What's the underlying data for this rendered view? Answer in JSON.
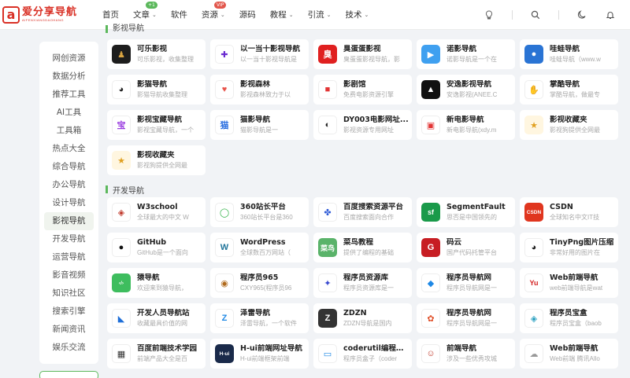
{
  "header": {
    "logo_mark": "a",
    "logo_title": "爱分享导航",
    "logo_sub": "AIFENXIANGDAOHANG",
    "nav": [
      {
        "label": "首页",
        "caret": false,
        "badge": ""
      },
      {
        "label": "文章",
        "caret": true,
        "badge": "+1",
        "badge_color": "#5cb85c"
      },
      {
        "label": "软件",
        "caret": false,
        "badge": ""
      },
      {
        "label": "资源",
        "caret": true,
        "badge": "VIP",
        "badge_color": "#e2574c"
      },
      {
        "label": "源码",
        "caret": false,
        "badge": ""
      },
      {
        "label": "教程",
        "caret": true,
        "badge": ""
      },
      {
        "label": "引流",
        "caret": true,
        "badge": ""
      },
      {
        "label": "技术",
        "caret": true,
        "badge": ""
      }
    ]
  },
  "sidebar": {
    "items": [
      "网创资源",
      "数据分析",
      "推荐工具",
      "AI工具",
      "工具箱",
      "热点大全",
      "综合导航",
      "办公导航",
      "设计导航",
      "影视导航",
      "开发导航",
      "运营导航",
      "影音视频",
      "知识社区",
      "搜索引擎",
      "新闻资讯",
      "娱乐交流"
    ],
    "active": "影视导航"
  },
  "sections": [
    {
      "title": "影视导航",
      "cards": [
        {
          "name": "可乐影视",
          "desc": "可乐影视，收集整理",
          "icon": "cola-icon",
          "bg": "#1d1d1d",
          "fg": "#d9a441",
          "glyph": "♟"
        },
        {
          "name": "以一当十影视导航",
          "desc": "以一当十影视导航是",
          "icon": "plus-logo-icon",
          "bg": "#fff",
          "fg": "#6a2bd0",
          "glyph": "✚"
        },
        {
          "name": "臭蛋蛋影视",
          "desc": "臭蛋蛋影视导航，影",
          "icon": "smelly-egg-icon",
          "bg": "#e02020",
          "fg": "#fff",
          "glyph": "臭"
        },
        {
          "name": "诺影导航",
          "desc": "诺影导航是一个在",
          "icon": "play-icon",
          "bg": "#3fa0f0",
          "fg": "#fff",
          "glyph": "▶"
        },
        {
          "name": "哇蛙导航",
          "desc": "哇蛙导航（www.w",
          "icon": "frog-icon",
          "bg": "#2a74d4",
          "fg": "#fff",
          "glyph": "●"
        },
        {
          "name": "影猫导航",
          "desc": "影猫导航收集整理",
          "icon": "panda-icon",
          "bg": "#fff",
          "fg": "#222",
          "glyph": "◕"
        },
        {
          "name": "影视森林",
          "desc": "影视森林致力于以",
          "icon": "heart-icon",
          "bg": "#fff",
          "fg": "#e8534a",
          "glyph": "♥"
        },
        {
          "name": "影剧馆",
          "desc": "免费电影资源引擎",
          "icon": "camera-icon",
          "bg": "#fff",
          "fg": "#e23434",
          "glyph": "■"
        },
        {
          "name": "安逸影视导航",
          "desc": "安逸影视(ANEE.C",
          "icon": "triangle-icon",
          "bg": "#111",
          "fg": "#fff",
          "glyph": "▲"
        },
        {
          "name": "掌酷导航",
          "desc": "掌酷导航，做最专",
          "icon": "hand-icon",
          "bg": "#fff",
          "fg": "#3b8ee0",
          "glyph": "✋"
        },
        {
          "name": "影视宝藏导航",
          "desc": "影视宝藏导航，一个",
          "icon": "treasure-icon",
          "bg": "#fff",
          "fg": "#9b3fe0",
          "glyph": "宝"
        },
        {
          "name": "猫影导航",
          "desc": "猫影导航是一",
          "icon": "cat-icon",
          "bg": "#fff",
          "fg": "#2b6fe0",
          "glyph": "猫"
        },
        {
          "name": "DY003电影网址...",
          "desc": "影视资源专用网址",
          "icon": "dy-icon",
          "bg": "#fff",
          "fg": "#222",
          "glyph": "◐"
        },
        {
          "name": "新电影导航",
          "desc": "新电影导航(xdy.m",
          "icon": "film-icon",
          "bg": "#fff",
          "fg": "#e23434",
          "glyph": "▣"
        },
        {
          "name": "影视收藏夹",
          "desc": "影视狗提供全网最",
          "icon": "bookmark-icon",
          "bg": "#fff6e0",
          "fg": "#e0a020",
          "glyph": "★"
        },
        {
          "name": "影视收藏夹",
          "desc": "影视狗提供全网最",
          "icon": "bookmark-icon",
          "bg": "#fff6e0",
          "fg": "#e0a020",
          "glyph": "★"
        }
      ]
    },
    {
      "title": "开发导航",
      "cards": [
        {
          "name": "W3school",
          "desc": "全球最大的中文 W",
          "icon": "w3-icon",
          "bg": "#fff",
          "fg": "#c0392b",
          "glyph": "◈"
        },
        {
          "name": "360站长平台",
          "desc": "360站长平台是360",
          "icon": "q-icon",
          "bg": "#fff",
          "fg": "#35b34a",
          "glyph": "◯"
        },
        {
          "name": "百度搜索资源平台",
          "desc": "百度搜索面向合作",
          "icon": "paw-icon",
          "bg": "#fff",
          "fg": "#2b58d6",
          "glyph": "✤"
        },
        {
          "name": "SegmentFault",
          "desc": "思否是中国领先的",
          "icon": "sf-icon",
          "bg": "#1a9a4a",
          "fg": "#fff",
          "glyph": "sf"
        },
        {
          "name": "CSDN",
          "desc": "全球知名中文IT技",
          "icon": "csdn-icon",
          "bg": "#e0361f",
          "fg": "#fff",
          "glyph": "CSDN"
        },
        {
          "name": "GitHub",
          "desc": "GitHub是一个面向",
          "icon": "github-icon",
          "bg": "#fff",
          "fg": "#111",
          "glyph": "●"
        },
        {
          "name": "WordPress",
          "desc": "全球数百万网站（",
          "icon": "wordpress-icon",
          "bg": "#fff",
          "fg": "#21759b",
          "glyph": "W"
        },
        {
          "name": "菜鸟教程",
          "desc": "提供了编程的基础",
          "icon": "runoob-icon",
          "bg": "#5ab36a",
          "fg": "#fff",
          "glyph": "菜鸟"
        },
        {
          "name": "码云",
          "desc": "国产代码托管平台",
          "icon": "gitee-icon",
          "bg": "#c71d23",
          "fg": "#fff",
          "glyph": "G"
        },
        {
          "name": "TinyPng图片压缩",
          "desc": "非常好用的图片在",
          "icon": "panda-face-icon",
          "bg": "#fff",
          "fg": "#222",
          "glyph": "◕"
        },
        {
          "name": "猿导航",
          "desc": "欢迎来到猿导航，",
          "icon": "code-bubble-icon",
          "bg": "#3ebd5e",
          "fg": "#fff",
          "glyph": "‹/›"
        },
        {
          "name": "程序员965",
          "desc": "CXY965(程序员96",
          "icon": "monkey-icon",
          "bg": "#fff",
          "fg": "#b06a1c",
          "glyph": "◉"
        },
        {
          "name": "程序员资源库",
          "desc": "程序员资源库是一",
          "icon": "star-x-icon",
          "bg": "#fff",
          "fg": "#3a4ad0",
          "glyph": "✦"
        },
        {
          "name": "程序员导航网",
          "desc": "程序员导航网是一",
          "icon": "cube-icon",
          "bg": "#fff",
          "fg": "#1e88e5",
          "glyph": "◆"
        },
        {
          "name": "Web前端导航",
          "desc": "web前端导航是wat",
          "icon": "yu-icon",
          "bg": "#fff",
          "fg": "#d32020",
          "glyph": "Yu"
        },
        {
          "name": "开发人员导航站",
          "desc": "收藏最具价值的网",
          "icon": "kite-icon",
          "bg": "#fff",
          "fg": "#1e6fd8",
          "glyph": "◣"
        },
        {
          "name": "泽雷导航",
          "desc": "泽雷导航，一个软件",
          "icon": "z-blue-icon",
          "bg": "#fff",
          "fg": "#1e88e5",
          "glyph": "Z"
        },
        {
          "name": "ZDZN",
          "desc": "ZDZN导航是国内",
          "icon": "z-dark-icon",
          "bg": "#333",
          "fg": "#fff",
          "glyph": "Z"
        },
        {
          "name": "程序员导航网",
          "desc": "程序员导航网是一",
          "icon": "flower-icon",
          "bg": "#fff",
          "fg": "#e0502a",
          "glyph": "✿"
        },
        {
          "name": "程序员宝盒",
          "desc": "程序员宝盒（baob",
          "icon": "diamond-icon",
          "bg": "#fff",
          "fg": "#2aa0c0",
          "glyph": "◈"
        },
        {
          "name": "百度前端技术学园",
          "desc": "前端产品大全是百",
          "icon": "ife-icon",
          "bg": "#fff",
          "fg": "#333",
          "glyph": "▦"
        },
        {
          "name": "H-ui前端网址导航",
          "desc": "H-ui前端框架前端",
          "icon": "hui-icon",
          "bg": "#1a2a4a",
          "fg": "#fff",
          "glyph": "H-ui"
        },
        {
          "name": "coderutil编程工...",
          "desc": "程序员盒子（coder",
          "icon": "coderutil-icon",
          "bg": "#fff",
          "fg": "#1e88e5",
          "glyph": "▭"
        },
        {
          "name": "前端导航",
          "desc": "涉及一些优秀攻城",
          "icon": "character-icon",
          "bg": "#fff",
          "fg": "#c0392b",
          "glyph": "☺"
        },
        {
          "name": "Web前端导航",
          "desc": "Web前端 腾讯Allo",
          "icon": "ghost-icon",
          "bg": "#fff",
          "fg": "#999",
          "glyph": "☁"
        }
      ]
    }
  ]
}
